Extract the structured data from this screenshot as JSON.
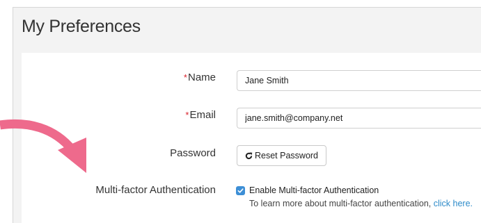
{
  "page": {
    "title": "My Preferences"
  },
  "form": {
    "name": {
      "required_mark": "*",
      "label": "Name",
      "value": "Jane Smith"
    },
    "email": {
      "required_mark": "*",
      "label": "Email",
      "value": "jane.smith@company.net"
    },
    "password": {
      "label": "Password",
      "button_label": "Reset Password",
      "button_icon": "refresh-icon"
    },
    "mfa": {
      "label": "Multi-factor Authentication",
      "checkbox_label": "Enable Multi-factor Authentication",
      "checked": true,
      "help_text": "To learn more about multi-factor authentication, ",
      "help_link": "click here."
    }
  },
  "annotation": {
    "arrow_color": "#ee6a8c"
  },
  "colors": {
    "required": "#d9232d",
    "link": "#2e8bc9",
    "checkbox": "#3d8fd6",
    "panel_background": "#f3f3f3"
  }
}
